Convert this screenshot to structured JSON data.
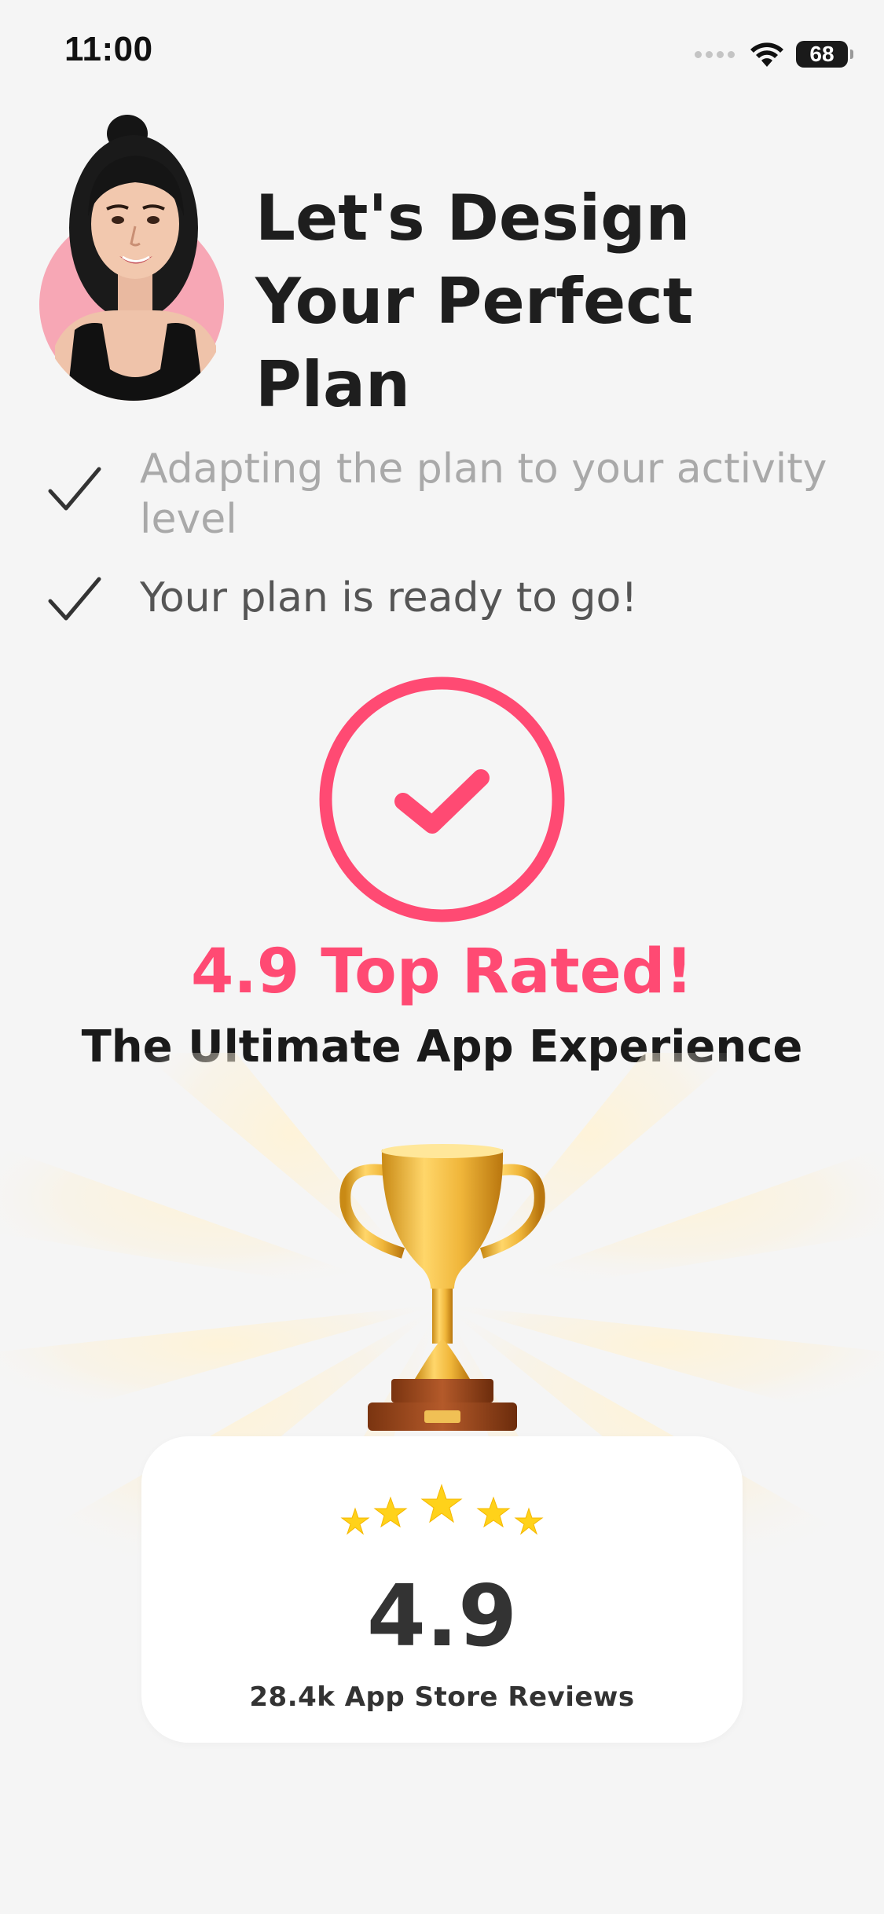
{
  "status_bar": {
    "time": "11:00",
    "battery": "68",
    "icons": [
      "signal-dots-icon",
      "wifi-icon",
      "battery-icon"
    ]
  },
  "header": {
    "avatar": "avatar",
    "title": "Let's Design Your Perfect Plan"
  },
  "checklist": [
    {
      "label": "Adapting the plan to your activity level",
      "state": "in-progress",
      "icon": "check-icon"
    },
    {
      "label": "Your plan is ready to go!",
      "state": "done",
      "icon": "check-icon"
    }
  ],
  "success": {
    "icon": "check-circle-icon",
    "rating_title": "4.9 Top Rated!",
    "subtitle": "The Ultimate App Experience"
  },
  "trophy": {
    "icon": "trophy-icon"
  },
  "review_card": {
    "stars": 5,
    "score": "4.9",
    "reviews": "28.4k App Store Reviews"
  },
  "colors": {
    "accent": "#ff4a73",
    "background": "#f5f5f5",
    "star": "#ffd21a",
    "avatar_bg": "#f7a7b5"
  }
}
